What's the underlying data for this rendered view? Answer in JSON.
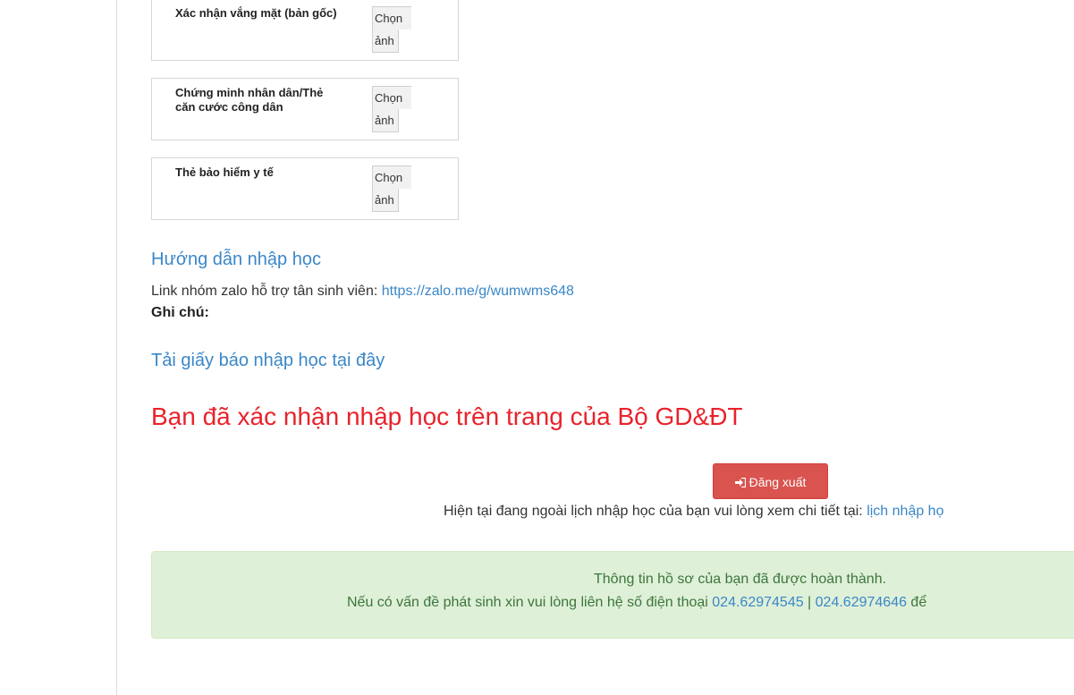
{
  "documents": [
    {
      "label": "Xác nhận vắng mặt (bản gốc)",
      "btn_line1": "Chọn",
      "btn_line2": "ảnh"
    },
    {
      "label": "Chứng minh nhân dân/Thẻ căn cước công dân",
      "btn_line1": "Chọn",
      "btn_line2": "ảnh"
    },
    {
      "label": "Thẻ bảo hiểm y tế",
      "btn_line1": "Chọn",
      "btn_line2": "ảnh"
    }
  ],
  "guide_link": "Hướng dẫn nhập học",
  "zalo": {
    "prefix": "Link nhóm zalo hỗ trợ tân sinh viên: ",
    "url": "https://zalo.me/g/wumwms648"
  },
  "note_label": "Ghi chú:",
  "download_link": "Tải giấy báo nhập học tại đây",
  "confirmed_message": "Bạn đã xác nhận nhập học trên trang của Bộ GD&ĐT",
  "logout": {
    "icon": "sign-out-icon",
    "label": "Đăng xuất"
  },
  "schedule": {
    "text": "Hiện tại đang ngoài lịch nhập học của bạn vui lòng xem chi tiết tại: ",
    "link": "lịch nhập họ"
  },
  "success": {
    "line1": "Thông tin hồ sơ của bạn đã được hoàn thành.",
    "line2_prefix": "Nếu có vấn đề phát sinh xin vui lòng liên hệ số điện thoại ",
    "phone1": "024.62974545",
    "separator": " | ",
    "phone2": "024.62974646",
    "line2_suffix": " để"
  },
  "colors": {
    "link": "#3a87c8",
    "confirmed": "#e8232b",
    "logout_bg": "#d9534f",
    "success_bg": "#dff0d8",
    "success_text": "#3c763d"
  }
}
